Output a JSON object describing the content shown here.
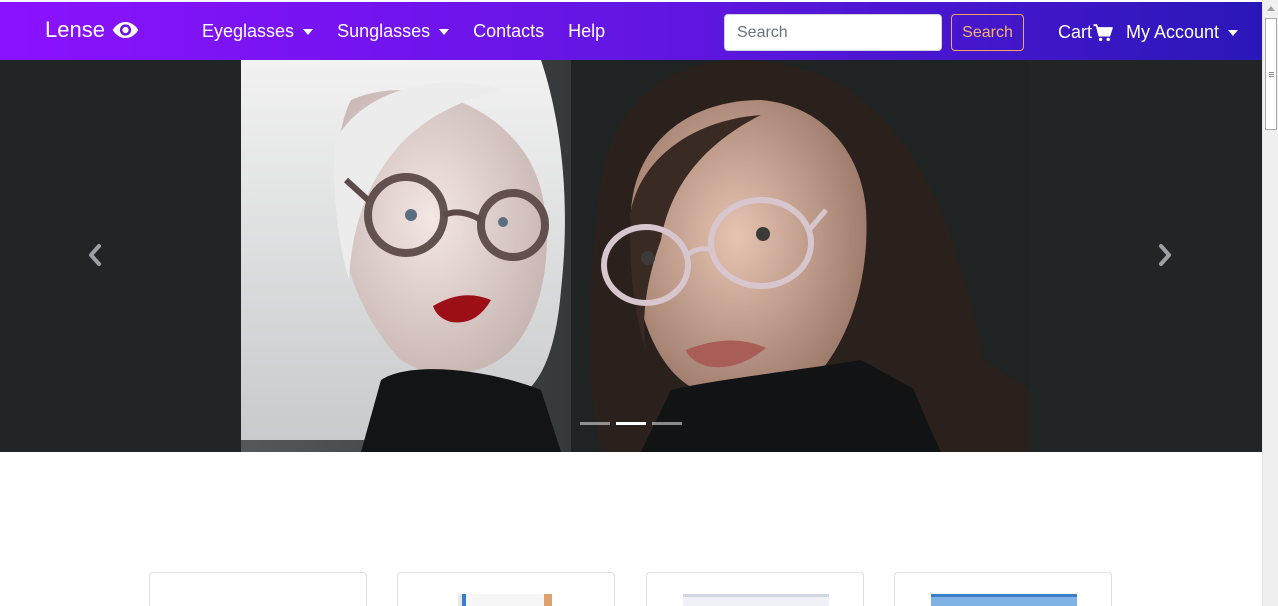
{
  "navbar": {
    "brand": "Lense",
    "brand_icon": "eye-icon",
    "links": [
      {
        "label": "Eyeglasses",
        "dropdown": true
      },
      {
        "label": "Sunglasses",
        "dropdown": true
      },
      {
        "label": "Contacts",
        "dropdown": false
      },
      {
        "label": "Help",
        "dropdown": false
      }
    ],
    "search": {
      "placeholder": "Search",
      "value": ""
    },
    "search_button": "Search",
    "cart_label": "Cart",
    "cart_icon": "shopping-cart-icon",
    "account_label": "My Account"
  },
  "carousel": {
    "slide_count": 3,
    "active_index": 1,
    "prev_icon": "chevron-left-icon",
    "next_icon": "chevron-right-icon"
  },
  "products": {
    "count_visible": 4
  },
  "colors": {
    "nav_gradient_start": "#8b12ff",
    "nav_gradient_end": "#2a17b8",
    "search_button_outline": "#f4a460",
    "carousel_bg": "#222526"
  }
}
